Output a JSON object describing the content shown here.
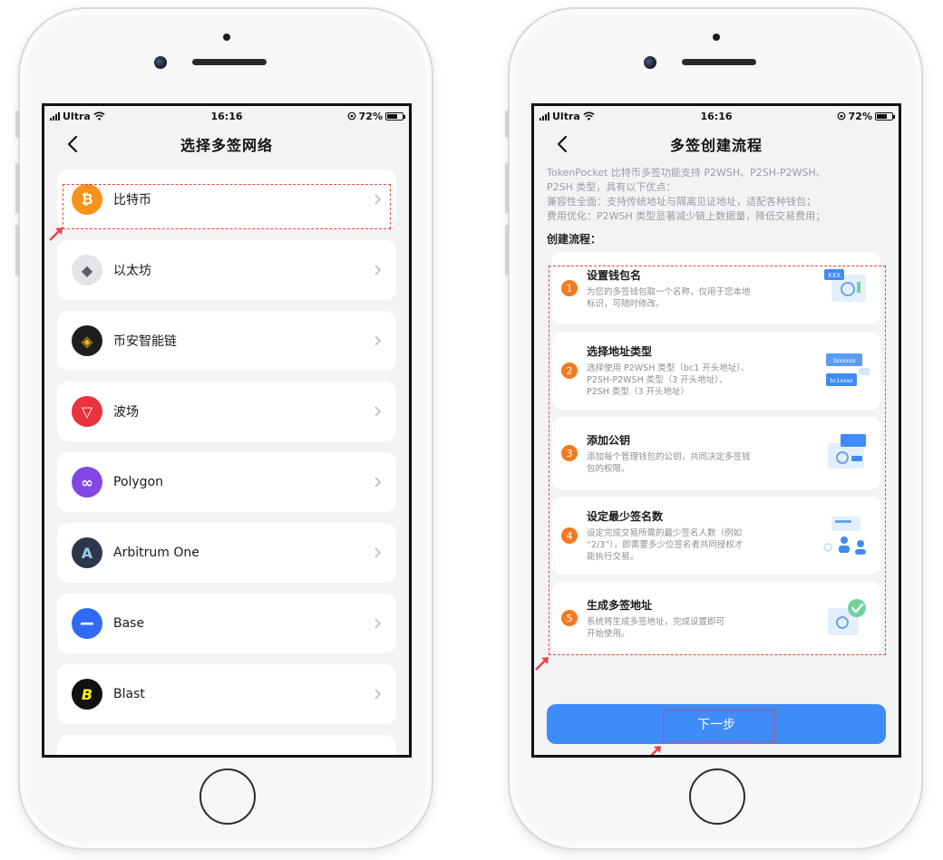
{
  "status_bar": {
    "carrier": "Ultra",
    "time": "16:16",
    "battery": "72%"
  },
  "left_screen": {
    "title": "选择多签网络",
    "networks": [
      {
        "name": "比特币",
        "logo_text": "₿",
        "color": "#f7931a"
      },
      {
        "name": "以太坊",
        "logo_text": "◆",
        "color": "#e3e4e8"
      },
      {
        "name": "币安智能链",
        "logo_text": "◈",
        "color": "#1e1e1e"
      },
      {
        "name": "波场",
        "logo_text": "▽",
        "color": "#e8323c"
      },
      {
        "name": "Polygon",
        "logo_text": "∞",
        "color": "#8247e5"
      },
      {
        "name": "Arbitrum One",
        "logo_text": "A",
        "color": "#2d374b"
      },
      {
        "name": "Base",
        "logo_text": "−",
        "color": "#2f6bf2"
      },
      {
        "name": "Blast",
        "logo_text": "B",
        "color": "#111111"
      }
    ]
  },
  "right_screen": {
    "title": "多签创建流程",
    "intro": [
      "TokenPocket 比特币多签功能支持 P2WSH、P2SH-P2WSH、",
      "P2SH 类型，具有以下优点：",
      "兼容性全面：支持传统地址与隔离见证地址，适配各种钱包；",
      "费用优化：P2WSH 类型显著减少链上数据量，降低交易费用；"
    ],
    "section_title": "创建流程：",
    "steps": [
      {
        "num": "1",
        "title": "设置钱包名",
        "desc": [
          "为您的多签钱包取一个名称，仅用于您本地",
          "标识，可随时修改。"
        ]
      },
      {
        "num": "2",
        "title": "选择地址类型",
        "desc": [
          "选择使用 P2WSH 类型（bc1 开头地址）、",
          "P2SH-P2WSH 类型（3 开头地址）、",
          "P2SH 类型（3 开头地址）"
        ]
      },
      {
        "num": "3",
        "title": "添加公钥",
        "desc": [
          "添加每个管理钱包的公钥，共同决定多签钱",
          "包的权限。"
        ]
      },
      {
        "num": "4",
        "title": "设定最少签名数",
        "desc": [
          "设定完成交易所需的最少签名人数（例如",
          "“2/3”），即需要多少位签名者共同授权才",
          "能执行交易。"
        ]
      },
      {
        "num": "5",
        "title": "生成多签地址",
        "desc": [
          "系统将生成多签地址，完成设置即可",
          "开始使用。"
        ]
      }
    ],
    "step_art_labels": {
      "wallet_name": "XXX",
      "addr_type_1": "3xxxxxx",
      "addr_type_2": "bc1xxxx"
    },
    "next_button": "下一步"
  },
  "colors": {
    "accent_blue": "#3f8bf7",
    "step_orange": "#f47a1f",
    "highlight_red": "#e64545"
  }
}
